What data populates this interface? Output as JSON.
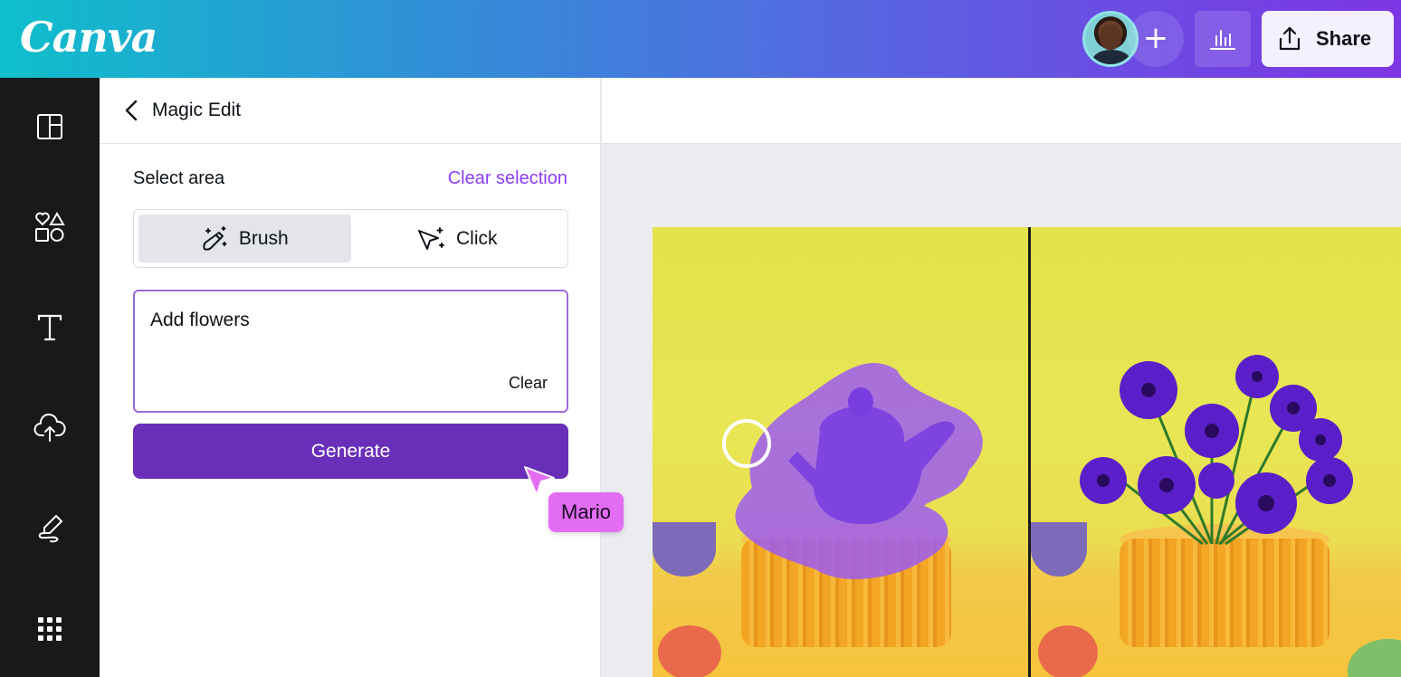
{
  "header": {
    "logo": "Canva",
    "add_label": "+",
    "share_label": "Share"
  },
  "rail": {
    "items": [
      "design-icon",
      "elements-icon",
      "text-icon",
      "uploads-icon",
      "draw-icon",
      "apps-icon"
    ]
  },
  "panel": {
    "title": "Magic Edit",
    "section_label": "Select area",
    "clear_selection": "Clear selection",
    "modes": [
      {
        "label": "Brush",
        "active": true
      },
      {
        "label": "Click",
        "active": false
      }
    ],
    "prompt_value": "Add flowers",
    "prompt_clear": "Clear",
    "generate_label": "Generate"
  },
  "collaborator": {
    "name": "Mario",
    "color": "#e26df2"
  },
  "colors": {
    "accent": "#8b3dff",
    "generate": "#6a2fb9",
    "rail": "#18191b"
  }
}
